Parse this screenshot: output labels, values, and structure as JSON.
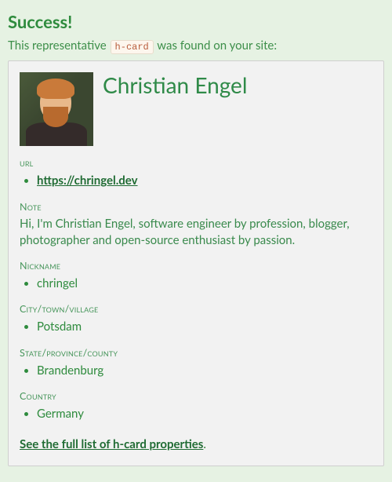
{
  "header": {
    "success_title": "Success!",
    "intro_prefix": "This representative ",
    "intro_code": "h-card",
    "intro_suffix": " was found on your site:"
  },
  "card": {
    "name": "Christian Engel",
    "sections": {
      "url": {
        "label": "url",
        "value": "https://chringel.dev"
      },
      "note": {
        "label": "Note",
        "value": "Hi, I'm Christian Engel, software engineer by profession, blogger, photographer and open-source enthusiast by passion."
      },
      "nickname": {
        "label": "Nickname",
        "value": "chringel"
      },
      "city": {
        "label": "City/town/village",
        "value": "Potsdam"
      },
      "state": {
        "label": "State/province/county",
        "value": "Brandenburg"
      },
      "country": {
        "label": "Country",
        "value": "Germany"
      }
    },
    "full_link": "See the full list of h-card properties"
  }
}
